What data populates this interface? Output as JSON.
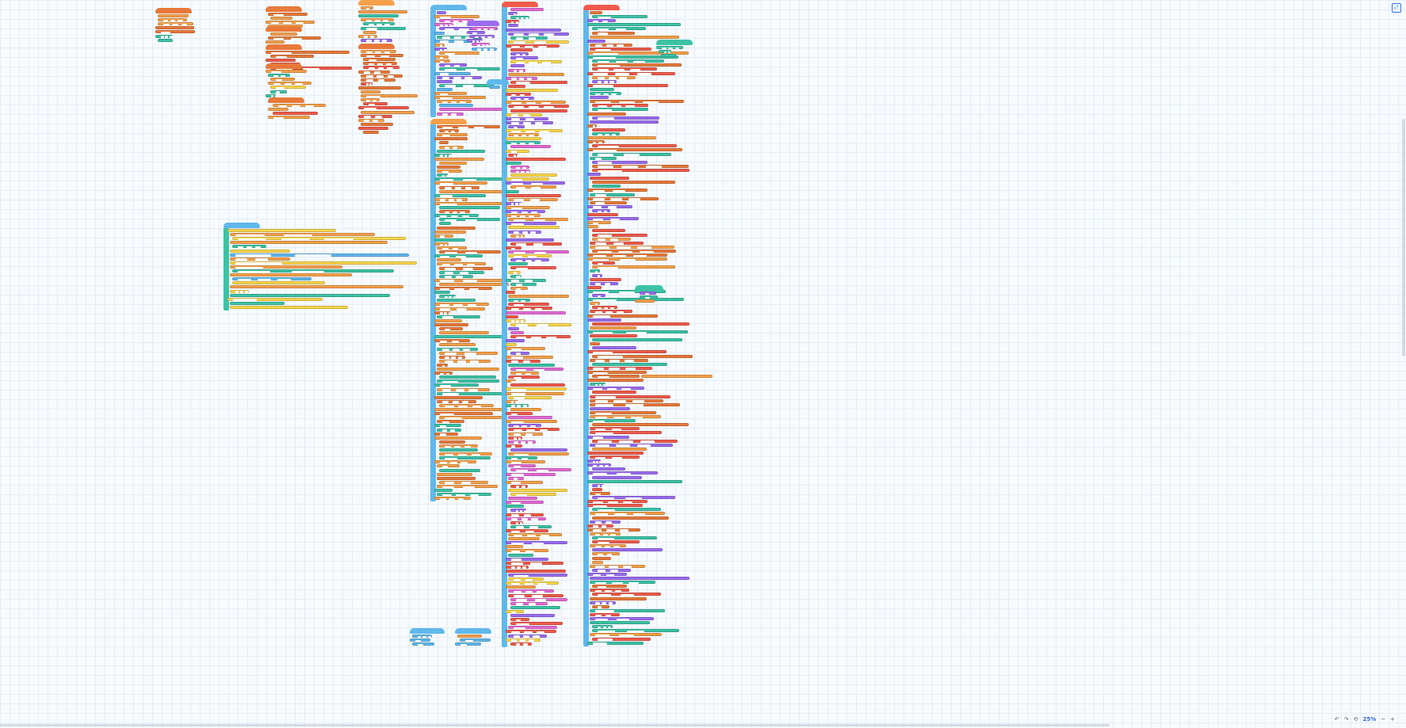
{
  "workspace": {
    "palette": {
      "orange": "#f5a04a",
      "orange_dark": "#e8793a",
      "red": "#ef5b4b",
      "teal": "#3cc3a6",
      "blue": "#5fb8ec",
      "purple": "#9a6cf0",
      "pink": "#e36bd4",
      "yellow": "#f9d64c",
      "green": "#5ac26a"
    },
    "icons": {
      "fullscreen": "fullscreen-icon",
      "zoom_out": "zoom-out-icon",
      "zoom_in": "zoom-in-icon",
      "reset": "reset-icon"
    }
  },
  "toolbar": {
    "zoom_level": "25%",
    "zoom_out_glyph": "−",
    "zoom_in_glyph": "+",
    "reset_glyph": "⟲",
    "fullscreen_glyph": "⤢"
  }
}
